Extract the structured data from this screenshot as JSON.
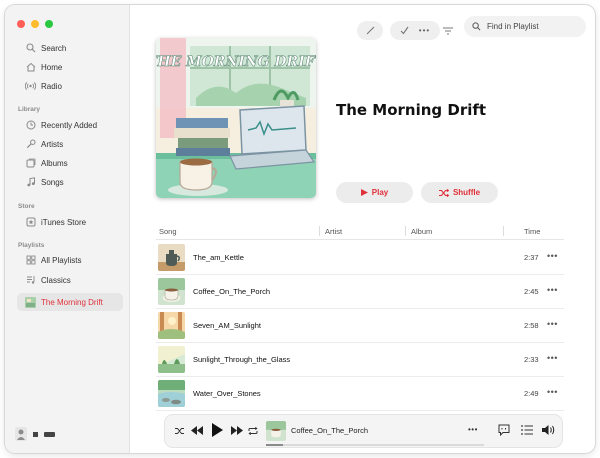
{
  "sidebar": {
    "items": [
      {
        "label": "Search",
        "icon": "search-icon"
      },
      {
        "label": "Home",
        "icon": "home-icon"
      },
      {
        "label": "Radio",
        "icon": "radio-icon"
      }
    ],
    "library": {
      "heading": "Library",
      "items": [
        {
          "label": "Recently Added",
          "icon": "clock-icon"
        },
        {
          "label": "Artists",
          "icon": "microphone-icon"
        },
        {
          "label": "Albums",
          "icon": "album-icon"
        },
        {
          "label": "Songs",
          "icon": "music-note-icon"
        }
      ]
    },
    "store": {
      "heading": "Store",
      "items": [
        {
          "label": "iTunes Store",
          "icon": "star-icon"
        }
      ]
    },
    "playlists": {
      "heading": "Playlists",
      "items": [
        {
          "label": "All Playlists",
          "icon": "grid-icon"
        },
        {
          "label": "Classics",
          "icon": "playlist-icon"
        },
        {
          "label": "The Morning Drift",
          "icon": "playlist-cover-icon",
          "active": true
        }
      ]
    }
  },
  "toolbar": {
    "search_placeholder": "Find in Playlist",
    "icons": [
      "pencil-icon",
      "checkmark-icon",
      "more-icon",
      "filter-icon"
    ]
  },
  "album": {
    "title": "The Morning Drift",
    "cover_text": "THE MORNING DRIFT",
    "play_label": "Play",
    "shuffle_label": "Shuffle"
  },
  "table": {
    "columns": [
      "Song",
      "Artist",
      "Album",
      "Time"
    ],
    "rows": [
      {
        "song": "The_am_Kettle",
        "time": "2:37"
      },
      {
        "song": "Coffee_On_The_Porch",
        "time": "2:45"
      },
      {
        "song": "Seven_AM_Sunlight",
        "time": "2:58"
      },
      {
        "song": "Sunlight_Through_the_Glass",
        "time": "2:33"
      },
      {
        "song": "Water_Over_Stones",
        "time": "2:49"
      }
    ],
    "more_label": "•••"
  },
  "player": {
    "now_playing": "Coffee_On_The_Porch",
    "progress": 0.08,
    "more_label": "•••"
  },
  "colors": {
    "accent": "#e0303a",
    "sidebar_bg": "#f3f3f3",
    "traffic_red": "#ff5f57",
    "traffic_yellow": "#febc2e",
    "traffic_green": "#28c840"
  }
}
